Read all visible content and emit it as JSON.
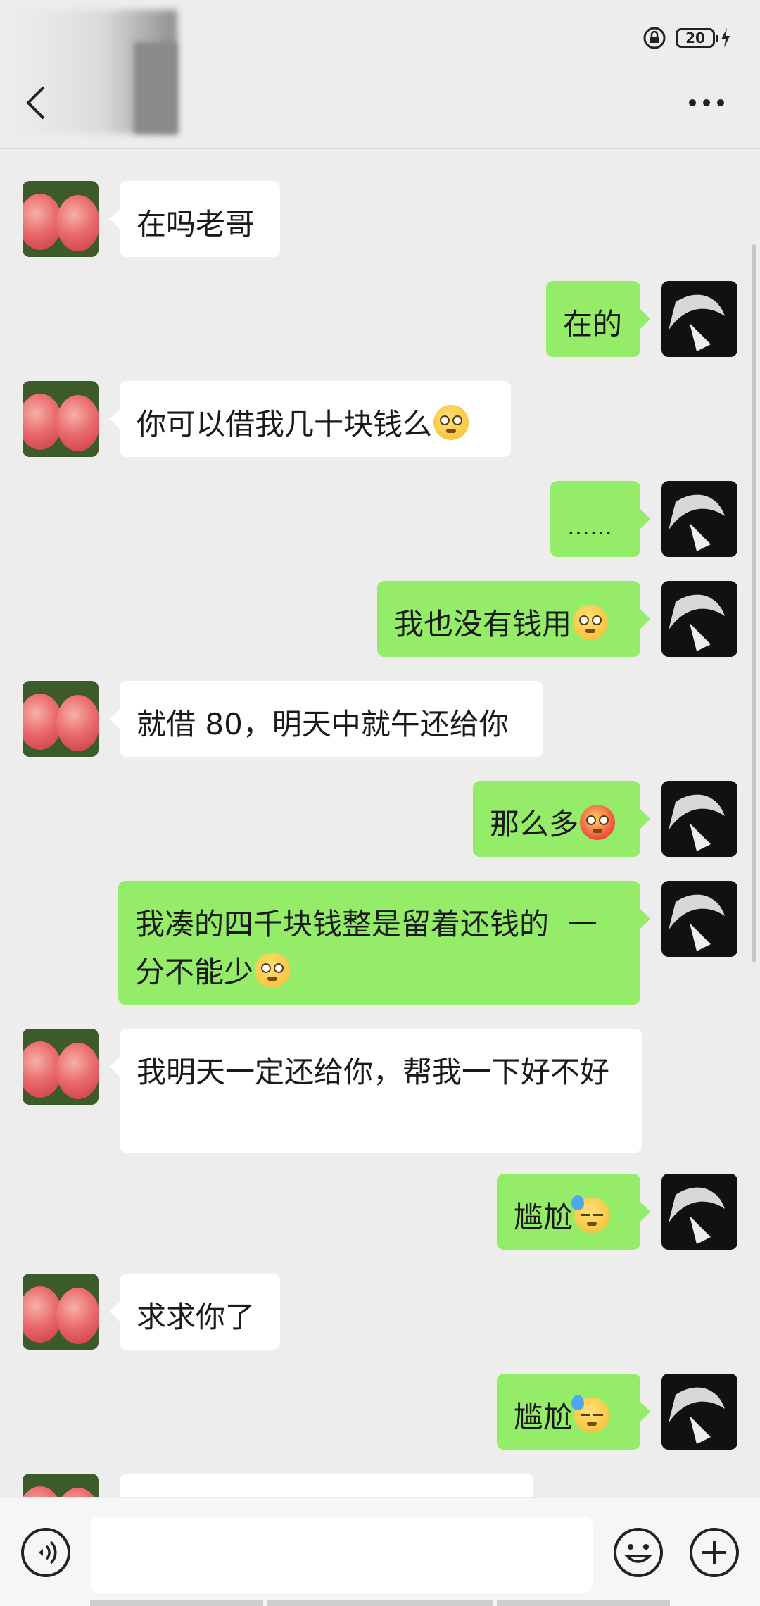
{
  "status": {
    "battery_level": "20"
  },
  "header": {
    "contact_name": ""
  },
  "messages": [
    {
      "side": "left",
      "text": "在吗老哥",
      "emoji": ""
    },
    {
      "side": "right",
      "text": "在的",
      "emoji": ""
    },
    {
      "side": "left",
      "text": "你可以借我几十块钱么",
      "emoji": "pleading-face"
    },
    {
      "side": "right",
      "text": "……",
      "emoji": ""
    },
    {
      "side": "right",
      "text": "我也没有钱用",
      "emoji": "pleading-face"
    },
    {
      "side": "left",
      "text": "就借 80，明天中就午还给你",
      "emoji": ""
    },
    {
      "side": "right",
      "text": "那么多",
      "emoji": "flushed-face"
    },
    {
      "side": "right",
      "text": "我凑的四千块钱整是留着还钱的  一分不能少",
      "emoji": "pleading-face"
    },
    {
      "side": "left",
      "text": "我明天一定还给你，帮我一下好不好",
      "emoji": ""
    },
    {
      "side": "right",
      "text": "尴尬",
      "emoji": "downcast-sweat-face"
    },
    {
      "side": "left",
      "text": "求求你了",
      "emoji": ""
    },
    {
      "side": "right",
      "text": "尴尬",
      "emoji": "downcast-sweat-face"
    },
    {
      "side": "left",
      "text": "",
      "emoji": ""
    }
  ],
  "input": {
    "value": "",
    "placeholder": ""
  },
  "icons": {
    "back": "back-arrow-icon",
    "more": "more-dots-icon",
    "voice": "voice-icon",
    "emoji": "emoji-icon",
    "plus": "plus-icon"
  },
  "colors": {
    "background": "#ededed",
    "sent_bubble": "#95ec69",
    "received_bubble": "#ffffff"
  }
}
